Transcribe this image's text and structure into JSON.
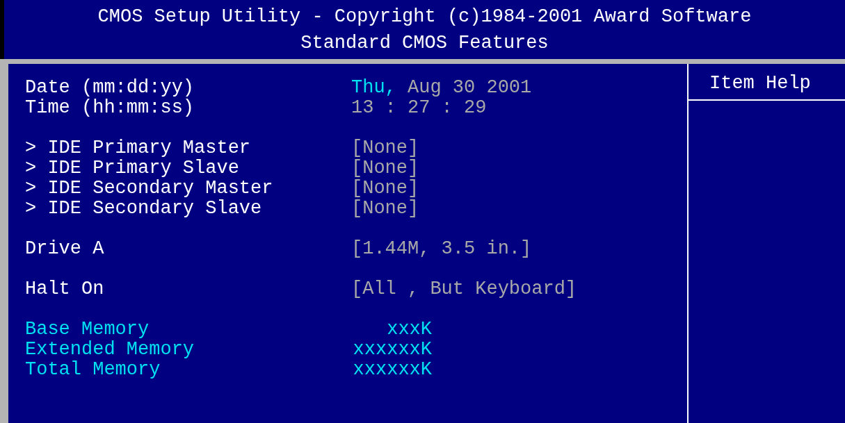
{
  "header": {
    "title": "CMOS Setup Utility - Copyright (c)1984-2001 Award Software",
    "subtitle": "Standard CMOS Features"
  },
  "groups": [
    [
      {
        "kind": "setting",
        "label": "Date (mm:dd:yy)",
        "weekday": "Thu,",
        "value": "Aug 30 2001"
      },
      {
        "kind": "setting",
        "label": "Time (hh:mm:ss)",
        "value": "13 : 27 : 29"
      }
    ],
    [
      {
        "kind": "submenu",
        "marker": ">",
        "label": "IDE Primary Master",
        "value": "[None]"
      },
      {
        "kind": "submenu",
        "marker": ">",
        "label": "IDE Primary Slave",
        "value": "[None]"
      },
      {
        "kind": "submenu",
        "marker": ">",
        "label": "IDE Secondary Master",
        "value": "[None]"
      },
      {
        "kind": "submenu",
        "marker": ">",
        "label": "IDE Secondary Slave",
        "value": "[None]"
      }
    ],
    [
      {
        "kind": "setting",
        "label": "Drive A",
        "value": "[1.44M, 3.5 in.]"
      }
    ],
    [
      {
        "kind": "setting",
        "label": "Halt On",
        "value": "[All , But Keyboard]"
      }
    ],
    [
      {
        "kind": "info",
        "label": "Base Memory",
        "value": "xxxK"
      },
      {
        "kind": "info",
        "label": "Extended Memory",
        "value": "xxxxxxK"
      },
      {
        "kind": "info",
        "label": "Total Memory",
        "value": "xxxxxxK"
      }
    ]
  ],
  "help": {
    "title": "Item Help"
  }
}
